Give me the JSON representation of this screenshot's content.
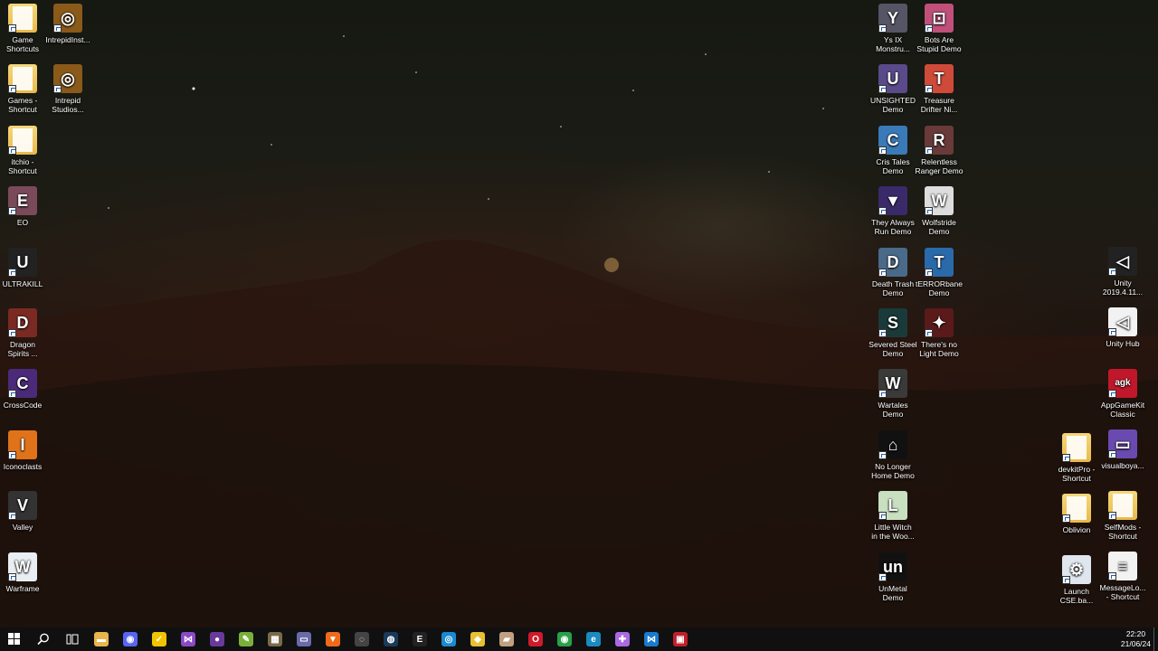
{
  "desktop": {
    "icons_left_col1": [
      {
        "label": "Game\nShortcuts",
        "icon": "folder-icon",
        "color": "#f0c75e",
        "glyph": ""
      },
      {
        "label": "Games -\nShortcut",
        "icon": "folder-icon",
        "color": "#f0c75e",
        "glyph": ""
      },
      {
        "label": "itchio -\nShortcut",
        "icon": "folder-icon",
        "color": "#f0c75e",
        "glyph": ""
      },
      {
        "label": "EO",
        "icon": "eo-game-icon",
        "color": "#7a4a5a",
        "glyph": "E"
      },
      {
        "label": "ULTRAKILL",
        "icon": "ultrakill-icon",
        "color": "#222222",
        "glyph": "U"
      },
      {
        "label": "Dragon\nSpirits ...",
        "icon": "dragon-spirits-icon",
        "color": "#7a2a22",
        "glyph": "D"
      },
      {
        "label": "CrossCode",
        "icon": "crosscode-icon",
        "color": "#4b2a7a",
        "glyph": "C"
      },
      {
        "label": "Iconoclasts",
        "icon": "iconoclasts-icon",
        "color": "#e0721a",
        "glyph": "I"
      },
      {
        "label": "Valley",
        "icon": "valley-icon",
        "color": "#333333",
        "glyph": "V"
      },
      {
        "label": "Warframe",
        "icon": "warframe-icon",
        "color": "#e8eef2",
        "glyph": "W"
      }
    ],
    "icons_left_col2": [
      {
        "label": "IntrepidInst...",
        "icon": "intrepid-installer-icon",
        "color": "#8a5a1a",
        "glyph": "◎"
      },
      {
        "label": "Intrepid\nStudios...",
        "icon": "intrepid-studios-icon",
        "color": "#8a5a1a",
        "glyph": "◎"
      }
    ],
    "icons_right_col1": [
      {
        "label": "Ys IX\nMonstru...",
        "icon": "ys-ix-icon",
        "color": "#555566",
        "glyph": "Y"
      },
      {
        "label": "UNSIGHTED\nDemo",
        "icon": "unsighted-icon",
        "color": "#5a4a8a",
        "glyph": "U"
      },
      {
        "label": "Cris Tales\nDemo",
        "icon": "cris-tales-icon",
        "color": "#3a7ab8",
        "glyph": "C"
      },
      {
        "label": "They Always\nRun Demo",
        "icon": "they-always-run-icon",
        "color": "#3a2a6a",
        "glyph": "▼"
      },
      {
        "label": "Death Trash\nDemo",
        "icon": "death-trash-icon",
        "color": "#4a6a8a",
        "glyph": "D"
      },
      {
        "label": "Severed Steel\nDemo",
        "icon": "severed-steel-icon",
        "color": "#1a3a3a",
        "glyph": "S"
      },
      {
        "label": "Wartales\nDemo",
        "icon": "wartales-icon",
        "color": "#3a3a3a",
        "glyph": "W"
      },
      {
        "label": "No Longer\nHome Demo",
        "icon": "no-longer-home-icon",
        "color": "#111111",
        "glyph": "⌂"
      },
      {
        "label": "Little Witch\nin the Woo...",
        "icon": "little-witch-icon",
        "color": "#c9e0c0",
        "glyph": "L"
      },
      {
        "label": "UnMetal\nDemo",
        "icon": "unmetal-icon",
        "color": "#111111",
        "glyph": "un"
      }
    ],
    "icons_right_col2": [
      {
        "label": "Bots Are\nStupid Demo",
        "icon": "bots-are-stupid-icon",
        "color": "#c0507a",
        "glyph": "⊡"
      },
      {
        "label": "Treasure\nDrifter Ni...",
        "icon": "treasure-drifter-icon",
        "color": "#d04a3a",
        "glyph": "T"
      },
      {
        "label": "Relentless\nRanger Demo",
        "icon": "relentless-ranger-icon",
        "color": "#6a3a3a",
        "glyph": "R"
      },
      {
        "label": "Wolfstride\nDemo",
        "icon": "wolfstride-icon",
        "color": "#dddddd",
        "glyph": "W"
      },
      {
        "label": "tERRORbane\nDemo",
        "icon": "terrorbane-icon",
        "color": "#2a6aaa",
        "glyph": "T"
      },
      {
        "label": "There's no\nLight Demo",
        "icon": "theres-no-light-icon",
        "color": "#5a1a1a",
        "glyph": "✦"
      }
    ],
    "icons_far_right_col1": [
      {
        "label": "devkitPro -\nShortcut",
        "icon": "folder-icon",
        "color": "#f0c75e",
        "glyph": ""
      },
      {
        "label": "Oblivion",
        "icon": "folder-icon",
        "color": "#f0c75e",
        "glyph": ""
      },
      {
        "label": "Launch\nCSE.ba...",
        "icon": "batch-file-icon",
        "color": "#dfe6ee",
        "glyph": "⚙"
      }
    ],
    "icons_far_right_col2": [
      {
        "label": "Unity\n2019.4.11...",
        "icon": "unity-icon",
        "color": "#222222",
        "glyph": "◁"
      },
      {
        "label": "Unity Hub",
        "icon": "unity-hub-icon",
        "color": "#f2f2f2",
        "glyph": "◁"
      },
      {
        "label": "AppGameKit\nClassic",
        "icon": "appgamekit-icon",
        "color": "#c0182a",
        "glyph": "agk"
      },
      {
        "label": "visualboya...",
        "icon": "visualboyadvance-icon",
        "color": "#6a4ab0",
        "glyph": "▭"
      },
      {
        "label": "SelfMods -\nShortcut",
        "icon": "folder-icon",
        "color": "#f0c75e",
        "glyph": ""
      },
      {
        "label": "MessageLo...\n- Shortcut",
        "icon": "text-file-icon",
        "color": "#f2f2f2",
        "glyph": "≡"
      }
    ]
  },
  "taskbar": {
    "apps": [
      {
        "name": "file-explorer-icon",
        "color": "#e8b64a",
        "glyph": "▬"
      },
      {
        "name": "discord-icon",
        "color": "#5865f2",
        "glyph": "◉"
      },
      {
        "name": "norton-icon",
        "color": "#f2c400",
        "glyph": "✓"
      },
      {
        "name": "visual-studio-icon",
        "color": "#8a4ac8",
        "glyph": "⋈"
      },
      {
        "name": "github-desktop-icon",
        "color": "#6a3a9a",
        "glyph": "●"
      },
      {
        "name": "notepad-plus-icon",
        "color": "#7ab03a",
        "glyph": "✎"
      },
      {
        "name": "app-icon-7",
        "color": "#7a6a4a",
        "glyph": "▦"
      },
      {
        "name": "gamepad-app-icon",
        "color": "#6a6aaa",
        "glyph": "▭"
      },
      {
        "name": "brave-icon",
        "color": "#f06a1a",
        "glyph": "▼"
      },
      {
        "name": "unity-taskbar-icon",
        "color": "#444444",
        "glyph": "◌"
      },
      {
        "name": "steam-icon",
        "color": "#1a3a5a",
        "glyph": "◍"
      },
      {
        "name": "epic-games-icon",
        "color": "#222222",
        "glyph": "E"
      },
      {
        "name": "app-icon-13",
        "color": "#1a8ad0",
        "glyph": "◎"
      },
      {
        "name": "app-icon-14",
        "color": "#e8c030",
        "glyph": "◆"
      },
      {
        "name": "app-icon-15",
        "color": "#c0a080",
        "glyph": "▰"
      },
      {
        "name": "opera-icon",
        "color": "#d01a2a",
        "glyph": "O"
      },
      {
        "name": "chrome-icon",
        "color": "#2aa04a",
        "glyph": "◉"
      },
      {
        "name": "edge-icon",
        "color": "#1a8ac0",
        "glyph": "e"
      },
      {
        "name": "game-controller-icon",
        "color": "#aa6ae0",
        "glyph": "✚"
      },
      {
        "name": "vscode-icon",
        "color": "#1a7ad0",
        "glyph": "⋈"
      },
      {
        "name": "video-editor-icon",
        "color": "#c0202a",
        "glyph": "▣"
      }
    ],
    "clock_time": "22:20",
    "clock_date": "21/06/24"
  }
}
